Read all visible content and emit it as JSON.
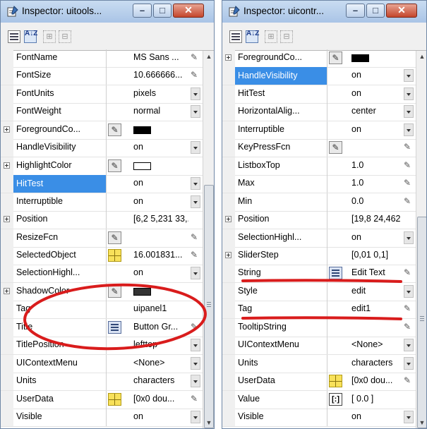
{
  "left": {
    "title": "Inspector:  uitools...",
    "rows": [
      {
        "name": "FontName",
        "value": "MS Sans ...",
        "kind": "pen"
      },
      {
        "name": "FontSize",
        "value": "10.666666...",
        "kind": "pen"
      },
      {
        "name": "FontUnits",
        "value": "pixels",
        "kind": "dd"
      },
      {
        "name": "FontWeight",
        "value": "normal",
        "kind": "dd"
      },
      {
        "name": "ForegroundCo...",
        "kind": "swatch",
        "expand": true,
        "icon": "pen",
        "swatch": "#000000"
      },
      {
        "name": "HandleVisibility",
        "value": "on",
        "kind": "dd"
      },
      {
        "name": "HighlightColor",
        "kind": "swatch",
        "expand": true,
        "icon": "pen",
        "swatch": "#ffffff"
      },
      {
        "name": "HitTest",
        "value": "on",
        "kind": "dd",
        "selected": true
      },
      {
        "name": "Interruptible",
        "value": "on",
        "kind": "dd"
      },
      {
        "name": "Position",
        "value": "[6,2 5,231 33,...",
        "kind": "none",
        "expand": true
      },
      {
        "name": "ResizeFcn",
        "kind": "pen",
        "icon": "pen"
      },
      {
        "name": "SelectedObject",
        "value": "16.001831...",
        "kind": "pen",
        "icon": "grid"
      },
      {
        "name": "SelectionHighl...",
        "value": "on",
        "kind": "dd"
      },
      {
        "name": "ShadowColor",
        "kind": "swatch",
        "expand": true,
        "icon": "pen",
        "swatch": "#333333"
      },
      {
        "name": "Tag",
        "value": "uipanel1",
        "kind": "none"
      },
      {
        "name": "Title",
        "value": "Button Gr...",
        "kind": "pen",
        "icon": "text"
      },
      {
        "name": "TitlePosition",
        "value": "lefttop",
        "kind": "dd"
      },
      {
        "name": "UIContextMenu",
        "value": "<None>",
        "kind": "dd"
      },
      {
        "name": "Units",
        "value": "characters",
        "kind": "dd"
      },
      {
        "name": "UserData",
        "value": "[0x0  dou...",
        "kind": "pen",
        "icon": "grid"
      },
      {
        "name": "Visible",
        "value": "on",
        "kind": "dd"
      }
    ]
  },
  "right": {
    "title": "Inspector:  uicontr...",
    "rows": [
      {
        "name": "ForegroundCo...",
        "kind": "swatch",
        "expand": true,
        "icon": "pen",
        "swatch": "#000000"
      },
      {
        "name": "HandleVisibility",
        "value": "on",
        "kind": "dd",
        "selected": true
      },
      {
        "name": "HitTest",
        "value": "on",
        "kind": "dd"
      },
      {
        "name": "HorizontalAlig...",
        "value": "center",
        "kind": "dd"
      },
      {
        "name": "Interruptible",
        "value": "on",
        "kind": "dd"
      },
      {
        "name": "KeyPressFcn",
        "kind": "pen",
        "icon": "pen"
      },
      {
        "name": "ListboxTop",
        "value": "1.0",
        "kind": "pen"
      },
      {
        "name": "Max",
        "value": "1.0",
        "kind": "pen"
      },
      {
        "name": "Min",
        "value": "0.0",
        "kind": "pen"
      },
      {
        "name": "Position",
        "value": "[19,8 24,462 ...",
        "kind": "none",
        "expand": true
      },
      {
        "name": "SelectionHighl...",
        "value": "on",
        "kind": "dd"
      },
      {
        "name": "SliderStep",
        "value": "[0,01 0,1]",
        "kind": "none",
        "expand": true
      },
      {
        "name": "String",
        "value": "Edit Text",
        "kind": "pen",
        "icon": "text"
      },
      {
        "name": "Style",
        "value": "edit",
        "kind": "dd"
      },
      {
        "name": "Tag",
        "value": "edit1",
        "kind": "pen"
      },
      {
        "name": "TooltipString",
        "kind": "pen"
      },
      {
        "name": "UIContextMenu",
        "value": "<None>",
        "kind": "dd"
      },
      {
        "name": "Units",
        "value": "characters",
        "kind": "dd"
      },
      {
        "name": "UserData",
        "value": "[0x0  dou...",
        "kind": "pen",
        "icon": "grid"
      },
      {
        "name": "Value",
        "value": "[ 0.0 ]",
        "kind": "none",
        "icon": "num"
      },
      {
        "name": "Visible",
        "value": "on",
        "kind": "dd"
      }
    ]
  },
  "toolbar": {
    "alpha_label": "A↓Z"
  },
  "annotations": {
    "color": "#d91c1c"
  }
}
